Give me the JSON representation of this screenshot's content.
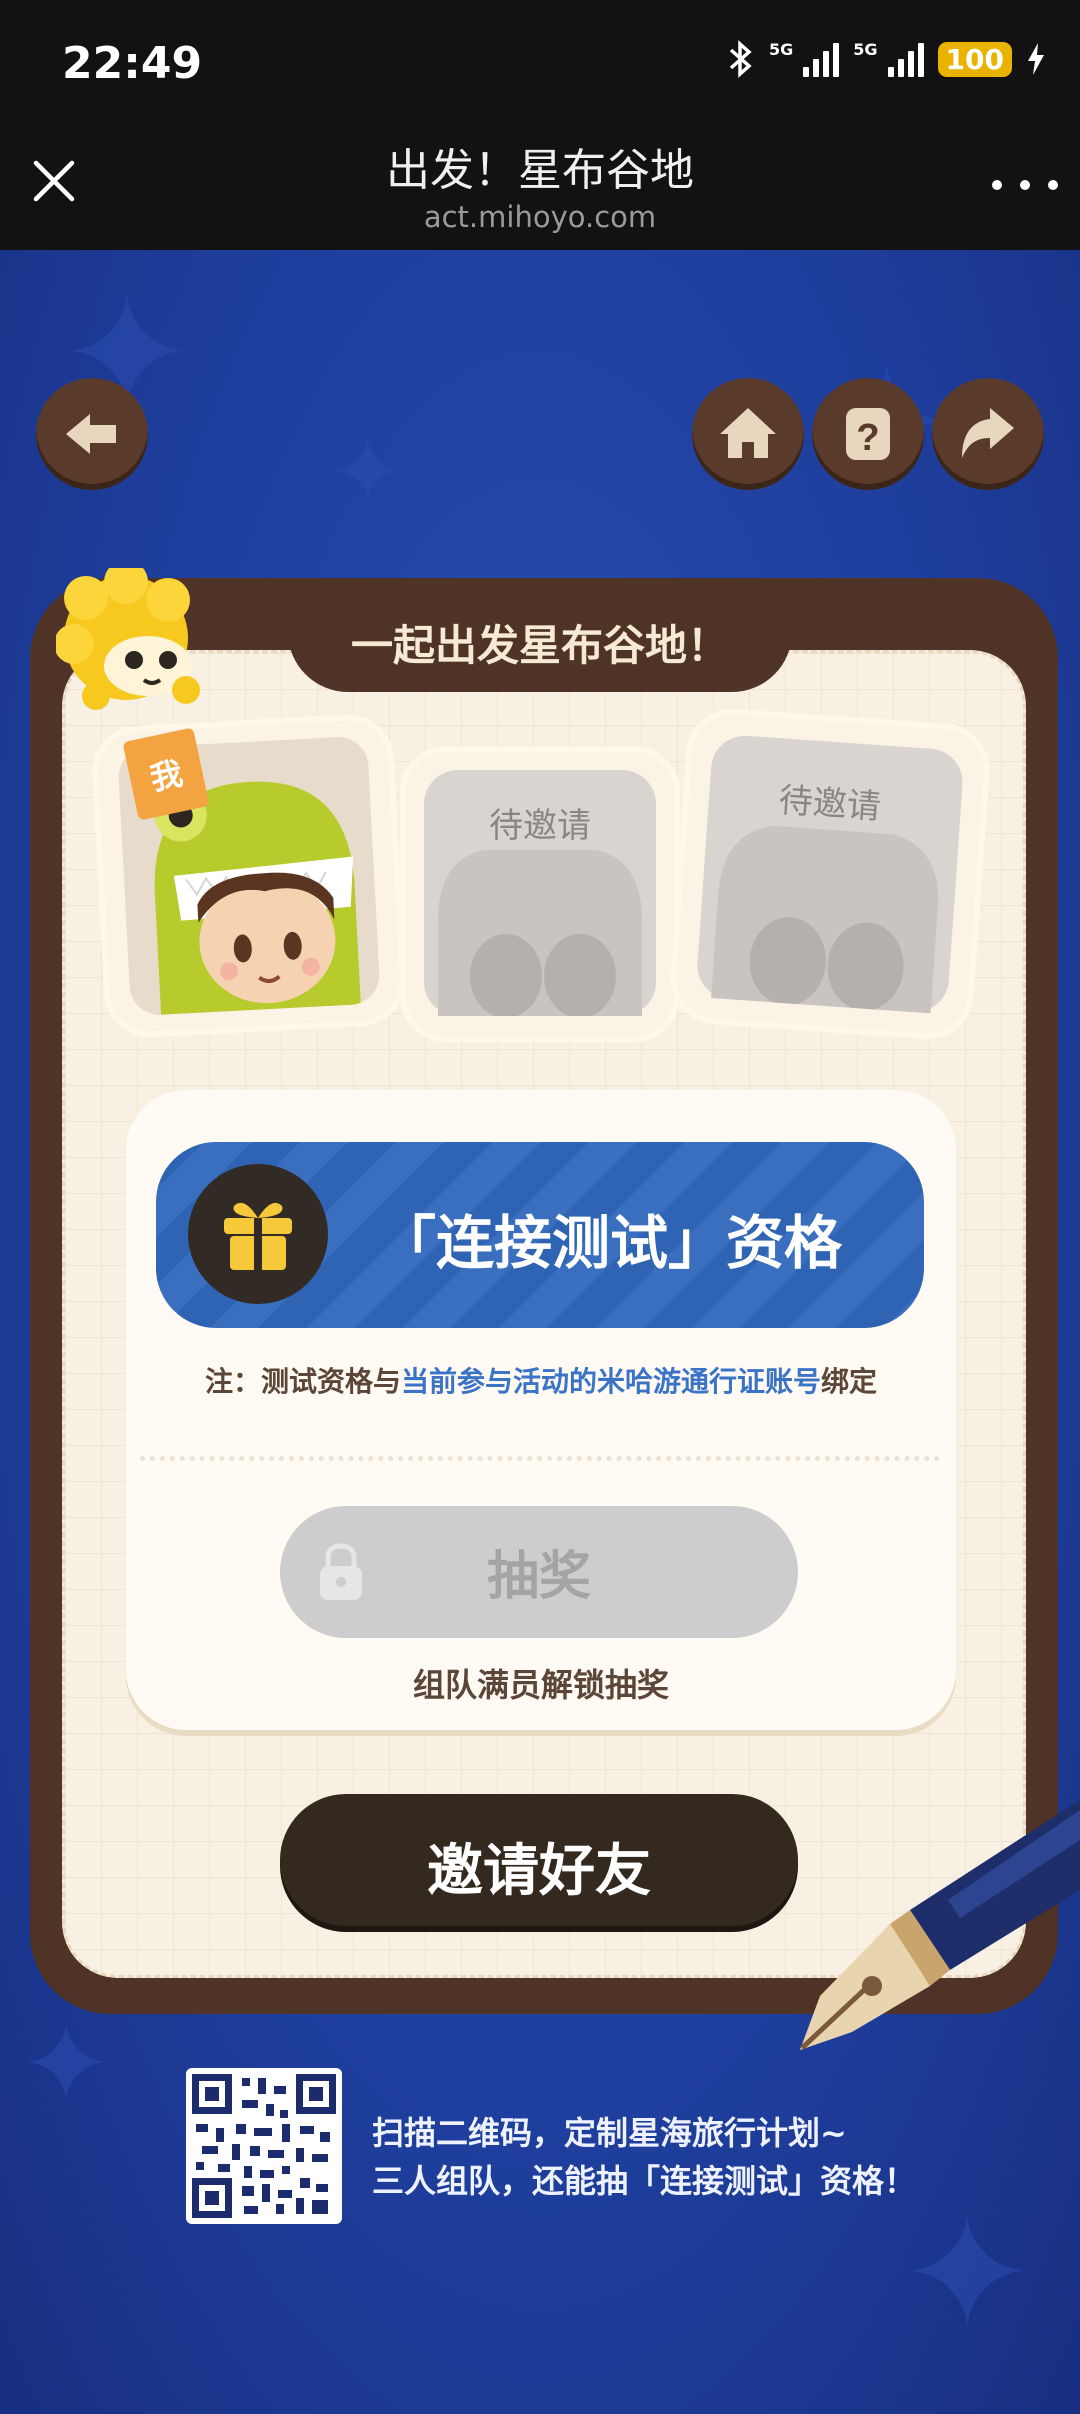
{
  "status_bar": {
    "time": "22:49",
    "net1": "5G",
    "net2": "5G",
    "battery": "100"
  },
  "header": {
    "title": "出发！星布谷地",
    "url": "act.mihoyo.com"
  },
  "nav": {
    "back_icon": "back-arrow-icon",
    "home_icon": "home-icon",
    "help_icon": "help-icon",
    "share_icon": "share-icon"
  },
  "card": {
    "title": "一起出发星布谷地！",
    "slots": [
      {
        "tag": "我"
      },
      {
        "label": "待邀请"
      },
      {
        "label": "待邀请"
      }
    ],
    "qualification": "「连接测试」资格",
    "note_prefix": "注：测试资格与",
    "note_highlight": "当前参与活动的米哈游通行证账号",
    "note_suffix": "绑定",
    "draw_button": "抽奖",
    "unlock_note": "组队满员解锁抽奖",
    "invite_button": "邀请好友"
  },
  "footer": {
    "line1": "扫描二维码，定制星海旅行计划~",
    "line2": "三人组队，还能抽「连接测试」资格！"
  },
  "colors": {
    "page_bg": "#1e3c98",
    "card_brown": "#4e3326",
    "qual_blue": "#2f63b3",
    "highlight": "#3b74c6"
  }
}
